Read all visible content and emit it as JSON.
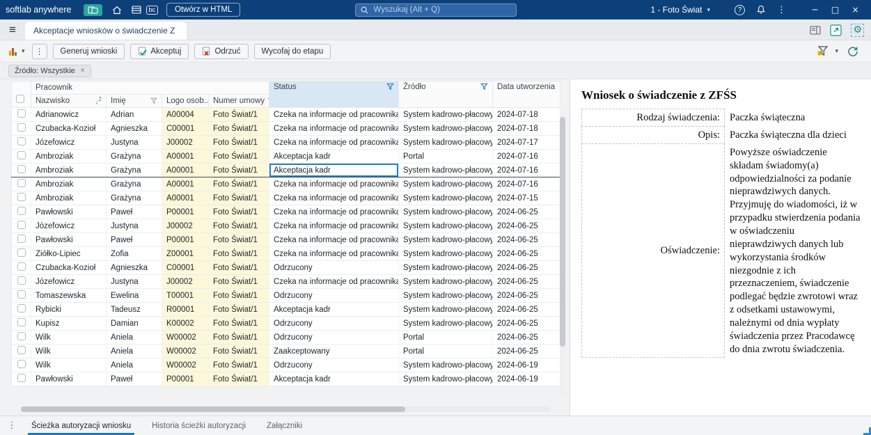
{
  "topbar": {
    "brand": "softlab anywhere",
    "open_html_label": "Otwórz w HTML",
    "search_placeholder": "Wyszukaj (Alt + Q)",
    "company": "1 - Foto Świat"
  },
  "tabbar": {
    "tab_label": "Akceptacje wniosków o świadczenie ZFŚS"
  },
  "toolbar": {
    "generate_label": "Generuj wnioski",
    "accept_label": "Akceptuj",
    "reject_label": "Odrzuć",
    "withdraw_label": "Wycofaj do etapu"
  },
  "chip": {
    "label": "Źródło: Wszystkie"
  },
  "table": {
    "group_header": "Pracownik",
    "headers": {
      "nazwisko": "Nazwisko",
      "imie": "Imię",
      "logo": "Logo osob...",
      "umowa": "Numer umowy",
      "status": "Status",
      "zrodlo": "Źródło",
      "data": "Data utworzenia"
    },
    "rows": [
      {
        "nazwisko": "Adrianowicz",
        "imie": "Adrian",
        "logo": "A00004",
        "umowa": "Foto Świat/1",
        "status": "Czeka na informacje od pracownika",
        "zrodlo": "System kadrowo-płacowy",
        "data": "2024-07-18"
      },
      {
        "nazwisko": "Czubacka-Kozioł",
        "imie": "Agnieszka",
        "logo": "C00001",
        "umowa": "Foto Świat/1",
        "status": "Czeka na informacje od pracownika",
        "zrodlo": "System kadrowo-płacowy",
        "data": "2024-07-18"
      },
      {
        "nazwisko": "Józefowicz",
        "imie": "Justyna",
        "logo": "J00002",
        "umowa": "Foto Świat/1",
        "status": "Czeka na informacje od pracownika",
        "zrodlo": "System kadrowo-płacowy",
        "data": "2024-07-17"
      },
      {
        "nazwisko": "Ambroziak",
        "imie": "Grażyna",
        "logo": "A00001",
        "umowa": "Foto Świat/1",
        "status": "Akceptacja kadr",
        "zrodlo": "Portal",
        "data": "2024-07-16"
      },
      {
        "nazwisko": "Ambroziak",
        "imie": "Grażyna",
        "logo": "A00001",
        "umowa": "Foto Świat/1",
        "status": "Akceptacja kadr",
        "zrodlo": "System kadrowo-płacowy",
        "data": "2024-07-16",
        "selected": true
      },
      {
        "nazwisko": "Ambroziak",
        "imie": "Grażyna",
        "logo": "A00001",
        "umowa": "Foto Świat/1",
        "status": "Czeka na informacje od pracownika",
        "zrodlo": "System kadrowo-płacowy",
        "data": "2024-07-16"
      },
      {
        "nazwisko": "Ambroziak",
        "imie": "Grażyna",
        "logo": "A00001",
        "umowa": "Foto Świat/1",
        "status": "Czeka na informacje od pracownika",
        "zrodlo": "System kadrowo-płacowy",
        "data": "2024-07-15"
      },
      {
        "nazwisko": "Pawłowski",
        "imie": "Paweł",
        "logo": "P00001",
        "umowa": "Foto Świat/1",
        "status": "Czeka na informacje od pracownika",
        "zrodlo": "System kadrowo-płacowy",
        "data": "2024-06-25"
      },
      {
        "nazwisko": "Józefowicz",
        "imie": "Justyna",
        "logo": "J00002",
        "umowa": "Foto Świat/1",
        "status": "Czeka na informacje od pracownika",
        "zrodlo": "System kadrowo-płacowy",
        "data": "2024-06-25"
      },
      {
        "nazwisko": "Pawłowski",
        "imie": "Paweł",
        "logo": "P00001",
        "umowa": "Foto Świat/1",
        "status": "Czeka na informacje od pracownika",
        "zrodlo": "System kadrowo-płacowy",
        "data": "2024-06-25"
      },
      {
        "nazwisko": "Ziółko-Lipiec",
        "imie": "Zofia",
        "logo": "Z00001",
        "umowa": "Foto Świat/1",
        "status": "Czeka na informacje od pracownika",
        "zrodlo": "System kadrowo-płacowy",
        "data": "2024-06-25"
      },
      {
        "nazwisko": "Czubacka-Kozioł",
        "imie": "Agnieszka",
        "logo": "C00001",
        "umowa": "Foto Świat/1",
        "status": "Odrzucony",
        "zrodlo": "System kadrowo-płacowy",
        "data": "2024-06-25"
      },
      {
        "nazwisko": "Józefowicz",
        "imie": "Justyna",
        "logo": "J00002",
        "umowa": "Foto Świat/1",
        "status": "Czeka na informacje od pracownika",
        "zrodlo": "System kadrowo-płacowy",
        "data": "2024-06-25"
      },
      {
        "nazwisko": "Tomaszewska",
        "imie": "Ewelina",
        "logo": "T00001",
        "umowa": "Foto Świat/1",
        "status": "Odrzucony",
        "zrodlo": "System kadrowo-płacowy",
        "data": "2024-06-25"
      },
      {
        "nazwisko": "Rybicki",
        "imie": "Tadeusz",
        "logo": "R00001",
        "umowa": "Foto Świat/1",
        "status": "Akceptacja kadr",
        "zrodlo": "System kadrowo-płacowy",
        "data": "2024-06-25"
      },
      {
        "nazwisko": "Kupisz",
        "imie": "Damian",
        "logo": "K00002",
        "umowa": "Foto Świat/1",
        "status": "Odrzucony",
        "zrodlo": "System kadrowo-płacowy",
        "data": "2024-06-25"
      },
      {
        "nazwisko": "Wilk",
        "imie": "Aniela",
        "logo": "W00002",
        "umowa": "Foto Świat/1",
        "status": "Odrzucony",
        "zrodlo": "Portal",
        "data": "2024-06-25"
      },
      {
        "nazwisko": "Wilk",
        "imie": "Aniela",
        "logo": "W00002",
        "umowa": "Foto Świat/1",
        "status": "Zaakceptowany",
        "zrodlo": "Portal",
        "data": "2024-06-25"
      },
      {
        "nazwisko": "Wilk",
        "imie": "Aniela",
        "logo": "W00002",
        "umowa": "Foto Świat/1",
        "status": "Odrzucony",
        "zrodlo": "System kadrowo-płacowy",
        "data": "2024-06-19"
      },
      {
        "nazwisko": "Pawłowski",
        "imie": "Paweł",
        "logo": "P00001",
        "umowa": "Foto Świat/1",
        "status": "Akceptacja kadr",
        "zrodlo": "System kadrowo-płacowy",
        "data": "2024-06-19"
      }
    ]
  },
  "detail": {
    "title": "Wniosek o świadczenie z ZFŚS",
    "fields": [
      {
        "label": "Rodzaj świadczenia:",
        "value": "Paczka świąteczna"
      },
      {
        "label": "Opis:",
        "value": "Paczka świąteczna dla dzieci"
      },
      {
        "label": "Oświadczenie:",
        "value": "Powyższe oświadczenie składam świadomy(a) odpowiedzialności za podanie nieprawdziwych danych. Przyjmuję do wiadomości, iż w przypadku stwierdzenia podania w oświadczeniu nieprawdziwych danych lub wykorzystania środków niezgodnie z ich przeznaczeniem, świadczenie podlegać będzie zwrotowi wraz z odsetkami ustawowymi, należnymi od dnia wypłaty świadczenia przez Pracodawcę do dnia zwrotu świadczenia."
      }
    ]
  },
  "bottom_tabs": [
    "Ścieżka autoryzacji wniosku",
    "Historia ścieżki autoryzacji",
    "Załączniki"
  ],
  "colors": {
    "topbar_blue": "#0d4078",
    "accent_teal": "#0e9488",
    "selection_blue": "#1b7fd4",
    "yellow_cell": "#fcf8da",
    "status_header_blue": "#d9e6f4"
  }
}
